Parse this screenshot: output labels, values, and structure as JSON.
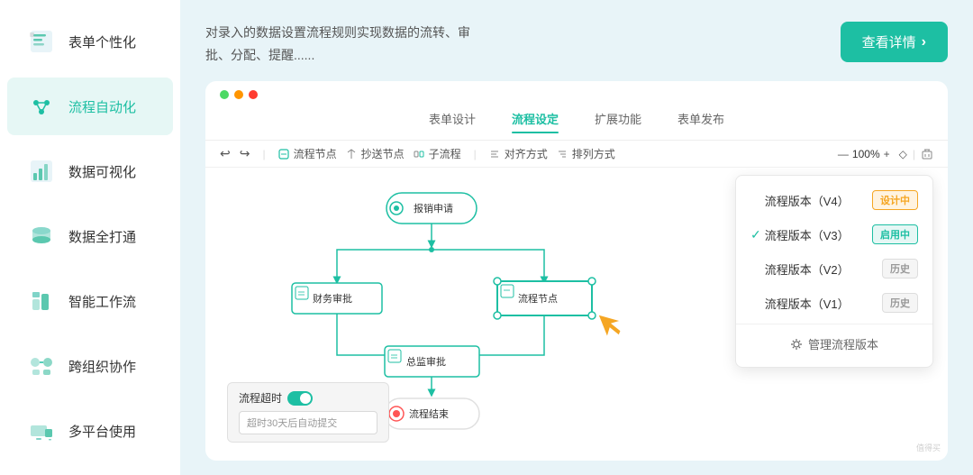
{
  "sidebar": {
    "items": [
      {
        "id": "form-personalization",
        "label": "表单个性化",
        "icon": "form-icon",
        "active": false
      },
      {
        "id": "flow-automation",
        "label": "流程自动化",
        "icon": "flow-icon",
        "active": true
      },
      {
        "id": "data-visualization",
        "label": "数据可视化",
        "icon": "data-icon",
        "active": false
      },
      {
        "id": "data-connect",
        "label": "数据全打通",
        "icon": "db-icon",
        "active": false
      },
      {
        "id": "smart-workflow",
        "label": "智能工作流",
        "icon": "smart-icon",
        "active": false
      },
      {
        "id": "cross-org",
        "label": "跨组织协作",
        "icon": "cross-icon",
        "active": false
      },
      {
        "id": "multi-platform",
        "label": "多平台使用",
        "icon": "multi-icon",
        "active": false
      }
    ]
  },
  "header": {
    "description_line1": "对录入的数据设置流程规则实现数据的流转、审",
    "description_line2": "批、分配、提醒......"
  },
  "detail_button": {
    "label": "查看详情",
    "chevron": "›"
  },
  "card": {
    "dots": [
      "green",
      "orange",
      "red"
    ],
    "tabs": [
      {
        "id": "form-design",
        "label": "表单设计",
        "active": false
      },
      {
        "id": "flow-settings",
        "label": "流程设定",
        "active": true
      },
      {
        "id": "extend-features",
        "label": "扩展功能",
        "active": false
      },
      {
        "id": "form-publish",
        "label": "表单发布",
        "active": false
      }
    ],
    "toolbar": {
      "undo": "↩",
      "redo": "↪",
      "flow_node": "流程节点",
      "copy_node": "抄送节点",
      "sub_flow": "子流程",
      "align": "对齐方式",
      "sort": "排列方式",
      "zoom_minus": "—",
      "zoom_value": "100%",
      "zoom_plus": "+",
      "reset": "◇",
      "delete": "🗑"
    },
    "flow": {
      "start_node": "报销申请",
      "finance_node": "财务审批",
      "flow_node": "流程节点",
      "monitor_node": "总监审批",
      "end_node": "流程结束"
    },
    "timeout": {
      "title": "流程超时",
      "input_placeholder": "超时30天后自动提交"
    },
    "versions": [
      {
        "label": "流程版本（V4）",
        "badge": "设计中",
        "badge_type": "design",
        "checked": false
      },
      {
        "label": "流程版本（V3）",
        "badge": "启用中",
        "badge_type": "active",
        "checked": true
      },
      {
        "label": "流程版本（V2）",
        "badge": "历史",
        "badge_type": "history",
        "checked": false
      },
      {
        "label": "流程版本（V1）",
        "badge": "历史",
        "badge_type": "history",
        "checked": false
      }
    ],
    "manage_label": "管理流程版本"
  },
  "watermark": "值得买"
}
